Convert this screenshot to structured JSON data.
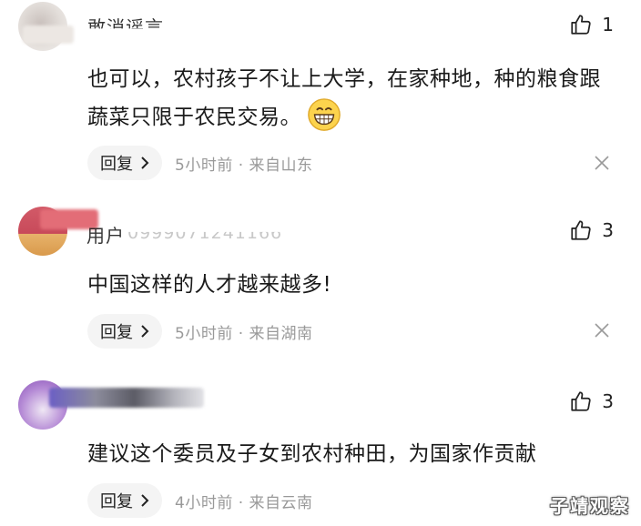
{
  "comments": [
    {
      "username": "敢消谣言",
      "likes": "1",
      "text": "也可以，农村孩子不让上大学，在家种地，种的粮食跟蔬菜只限于农民交易。",
      "reply_label": "回复",
      "meta": "5小时前 · 来自山东"
    },
    {
      "username": "用户",
      "user_id": "0999071241166",
      "likes": "3",
      "text": "中国这样的人才越来越多!",
      "reply_label": "回复",
      "meta": "5小时前 · 来自湖南"
    },
    {
      "likes": "3",
      "text": "建议这个委员及子女到农村种田，为国家作贡献",
      "reply_label": "回复",
      "meta": "4小时前 · 来自云南"
    }
  ],
  "watermark": "子靖观察",
  "icons": {
    "like": "thumbs-up-icon",
    "reply_arrow": "chevron-right-icon",
    "dismiss": "close-icon",
    "emoji": "grinning-face-icon"
  },
  "colors": {
    "meta_text": "#999999",
    "reply_bg": "#f4f4f4",
    "body_text": "#1a1a1a"
  }
}
